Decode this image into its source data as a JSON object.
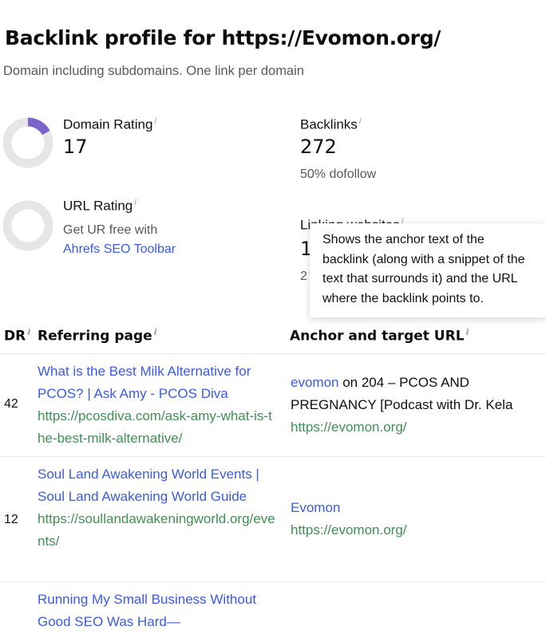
{
  "page": {
    "title": "Backlink profile for https://Evomon.org/",
    "subtitle": "Domain including subdomains. One link per domain"
  },
  "metrics": {
    "domain_rating": {
      "label": "Domain Rating",
      "value": "17",
      "gauge_fraction": 0.17,
      "gauge_color": "#7a63c9",
      "track_color": "#e6e6e6"
    },
    "backlinks": {
      "label": "Backlinks",
      "value": "272",
      "sub": "50% dofollow"
    },
    "url_rating": {
      "label": "URL Rating",
      "sub": "Get UR free with",
      "link": "Ahrefs SEO Toolbar",
      "track_color": "#e6e6e6"
    },
    "linking_websites": {
      "label": "Linking websites",
      "value": "1",
      "sub": "2"
    }
  },
  "info_icon": "info-icon",
  "tooltip": {
    "text": "Shows the anchor text of the backlink (along with a snippet of the text that surrounds it) and the URL where the backlink points to."
  },
  "table": {
    "headers": {
      "dr": "DR",
      "referring_page": "Referring page",
      "anchor": "Anchor and target URL"
    },
    "rows": [
      {
        "dr": "42",
        "ref_title": "What is the Best Milk Alternative for PCOS? | Ask Amy - PCOS Diva",
        "ref_url": "https://pcosdiva.com/ask-amy-what-is-the-best-milk-alternative/",
        "anchor": "evomon",
        "anchor_context": " on 204 – PCOS AND PREGNANCY [Podcast with Dr. Kela",
        "target_url": "https://evomon.org/"
      },
      {
        "dr": "12",
        "ref_title": "Soul Land Awakening World Events | Soul Land Awakening World Guide",
        "ref_url": "https://soullandawakeningworld.org/events/",
        "anchor": "Evomon",
        "anchor_context": "",
        "target_url": "https://evomon.org/"
      },
      {
        "dr": "",
        "ref_title": "Running My Small Business Without Good SEO Was Hard—",
        "ref_url": "",
        "anchor": "",
        "anchor_context": "",
        "target_url": ""
      }
    ]
  },
  "colors": {
    "link": "#3a5ce4",
    "url": "#3f8f55",
    "muted": "#555a60"
  }
}
